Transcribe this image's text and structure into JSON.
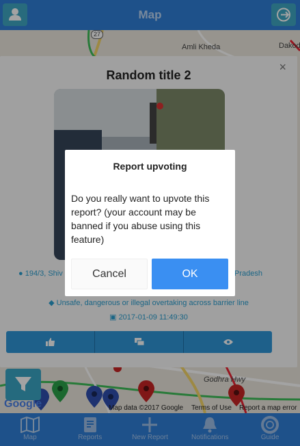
{
  "header": {
    "title": "Map"
  },
  "map": {
    "labels": {
      "road_badge": "27",
      "place1": "Amli Kheda",
      "place2": "Dakod",
      "place3": "Godhra Hwy",
      "place4": "Pradesh"
    },
    "footer": {
      "data": "Map data ©2017 Google",
      "terms": "Terms of Use",
      "error": "Report a map error",
      "logo": "Google"
    }
  },
  "card": {
    "title": "Random title 2",
    "close": "×",
    "address_left": "194/3, Shiv N",
    "address_right": "Pradesh",
    "category": "Unsafe, dangerous or illegal overtaking across barrier line",
    "datetime": "2017-01-09 11:49:30"
  },
  "dialog": {
    "title": "Report upvoting",
    "body": "Do you really want to upvote this report? (your account may be banned if you abuse using this feature)",
    "cancel_label": "Cancel",
    "ok_label": "OK"
  },
  "tabs": [
    {
      "label": "Map",
      "icon": "map-icon"
    },
    {
      "label": "Reports",
      "icon": "reports-icon"
    },
    {
      "label": "New Report",
      "icon": "plus-icon"
    },
    {
      "label": "Notifications",
      "icon": "bell-icon"
    },
    {
      "label": "Guide",
      "icon": "lifebuoy-icon"
    }
  ],
  "colors": {
    "primary": "#2f7fd8",
    "accent": "#3aa7c6",
    "ok": "#3a8ff2",
    "link": "#2a9fd0"
  }
}
